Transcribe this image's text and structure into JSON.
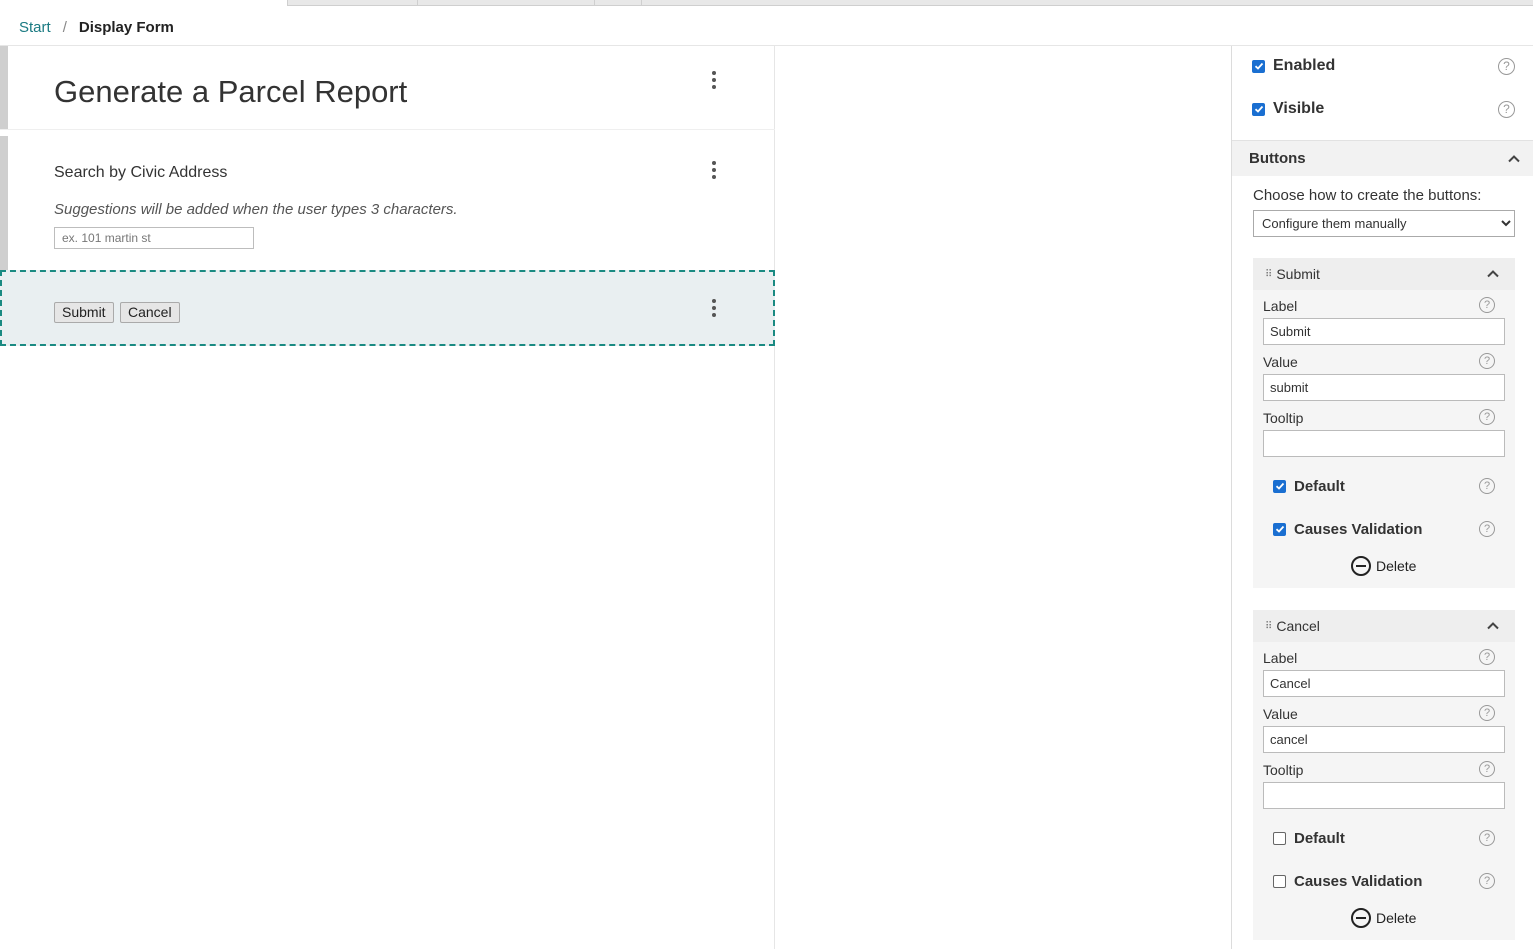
{
  "breadcrumb": {
    "start": "Start",
    "separator": "/",
    "current": "Display Form"
  },
  "form": {
    "title": "Generate a Parcel Report",
    "search": {
      "label": "Search by Civic Address",
      "help": "Suggestions will be added when the user types 3 characters.",
      "placeholder": "ex. 101 martin st"
    },
    "buttons": {
      "submit": "Submit",
      "cancel": "Cancel"
    }
  },
  "panel": {
    "enabled": {
      "label": "Enabled",
      "checked": true
    },
    "visible": {
      "label": "Visible",
      "checked": true
    },
    "buttons_section": {
      "title": "Buttons",
      "choose_label": "Choose how to create the buttons:",
      "mode_selected": "Configure them manually"
    },
    "cards": [
      {
        "title": "Submit",
        "label_caption": "Label",
        "label_value": "Submit",
        "value_caption": "Value",
        "value_value": "submit",
        "tooltip_caption": "Tooltip",
        "tooltip_value": "",
        "default_label": "Default",
        "default_checked": true,
        "validation_label": "Causes Validation",
        "validation_checked": true,
        "delete_label": "Delete"
      },
      {
        "title": "Cancel",
        "label_caption": "Label",
        "label_value": "Cancel",
        "value_caption": "Value",
        "value_value": "cancel",
        "tooltip_caption": "Tooltip",
        "tooltip_value": "",
        "default_label": "Default",
        "default_checked": false,
        "validation_label": "Causes Validation",
        "validation_checked": false,
        "delete_label": "Delete"
      }
    ],
    "help_glyph": "?"
  },
  "colors": {
    "accent": "#1a8a82",
    "link": "#1a7a82",
    "checkbox": "#1a6fd1",
    "selected_bg": "#e9eff1"
  }
}
